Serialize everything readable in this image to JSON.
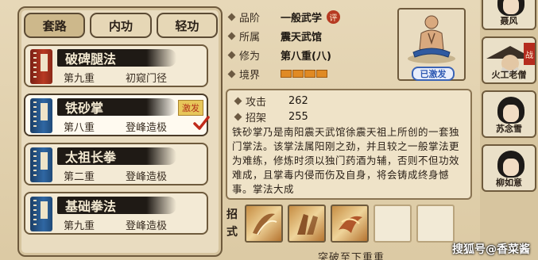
{
  "tabs": [
    {
      "label": "套路",
      "active": true
    },
    {
      "label": "内功",
      "active": false
    },
    {
      "label": "轻功",
      "active": false
    }
  ],
  "skills": [
    {
      "name": "破碑腿法",
      "level": "第九重",
      "stage": "初窥门径",
      "book_color": "red",
      "selected": false,
      "badge": ""
    },
    {
      "name": "铁砂掌",
      "level": "第八重",
      "stage": "登峰造极",
      "book_color": "blue",
      "selected": true,
      "badge": "激发"
    },
    {
      "name": "太祖长拳",
      "level": "第二重",
      "stage": "登峰造极",
      "book_color": "blue",
      "selected": false,
      "badge": ""
    },
    {
      "name": "基础拳法",
      "level": "第九重",
      "stage": "登峰造极",
      "book_color": "blue",
      "selected": false,
      "badge": ""
    }
  ],
  "info": {
    "grade_label": "品阶",
    "grade_value": "一般武学",
    "grade_badge": "评",
    "sect_label": "所属",
    "sect_value": "震天武馆",
    "cultivation_label": "修为",
    "cultivation_value": "第八重(八)",
    "realm_label": "境界",
    "realm_segments": 4,
    "activated_label": "已激发"
  },
  "stats": {
    "attack_label": "攻击",
    "attack_value": "262",
    "parry_label": "招架",
    "parry_value": "255",
    "description": "铁砂掌乃是南阳震天武馆徐震天祖上所创的一套独门掌法。该掌法属阳刚之劲，并且较之一般掌法更为难练，修炼时须以独门药酒为辅，否则不但功效难成，且掌毒内侵而伤及自身，将会铸成终身憾事。掌法大成"
  },
  "moves": {
    "label_top": "招",
    "label_bottom": "式",
    "slots": [
      "filled",
      "filled",
      "filled",
      "empty",
      "empty"
    ]
  },
  "breakthrough_text": "突破至下重重",
  "characters": [
    {
      "name": "聂风",
      "battle": false
    },
    {
      "name": "火工老僧",
      "battle": true
    },
    {
      "name": "苏念雪",
      "battle": false
    },
    {
      "name": "柳如意",
      "battle": false
    }
  ],
  "battle_tag": "战",
  "watermark": "搜狐号@香菜酱",
  "colors": {
    "accent_orange": "#e08a24",
    "badge_red": "#b63a22",
    "activated_blue": "#2f5ab3"
  }
}
